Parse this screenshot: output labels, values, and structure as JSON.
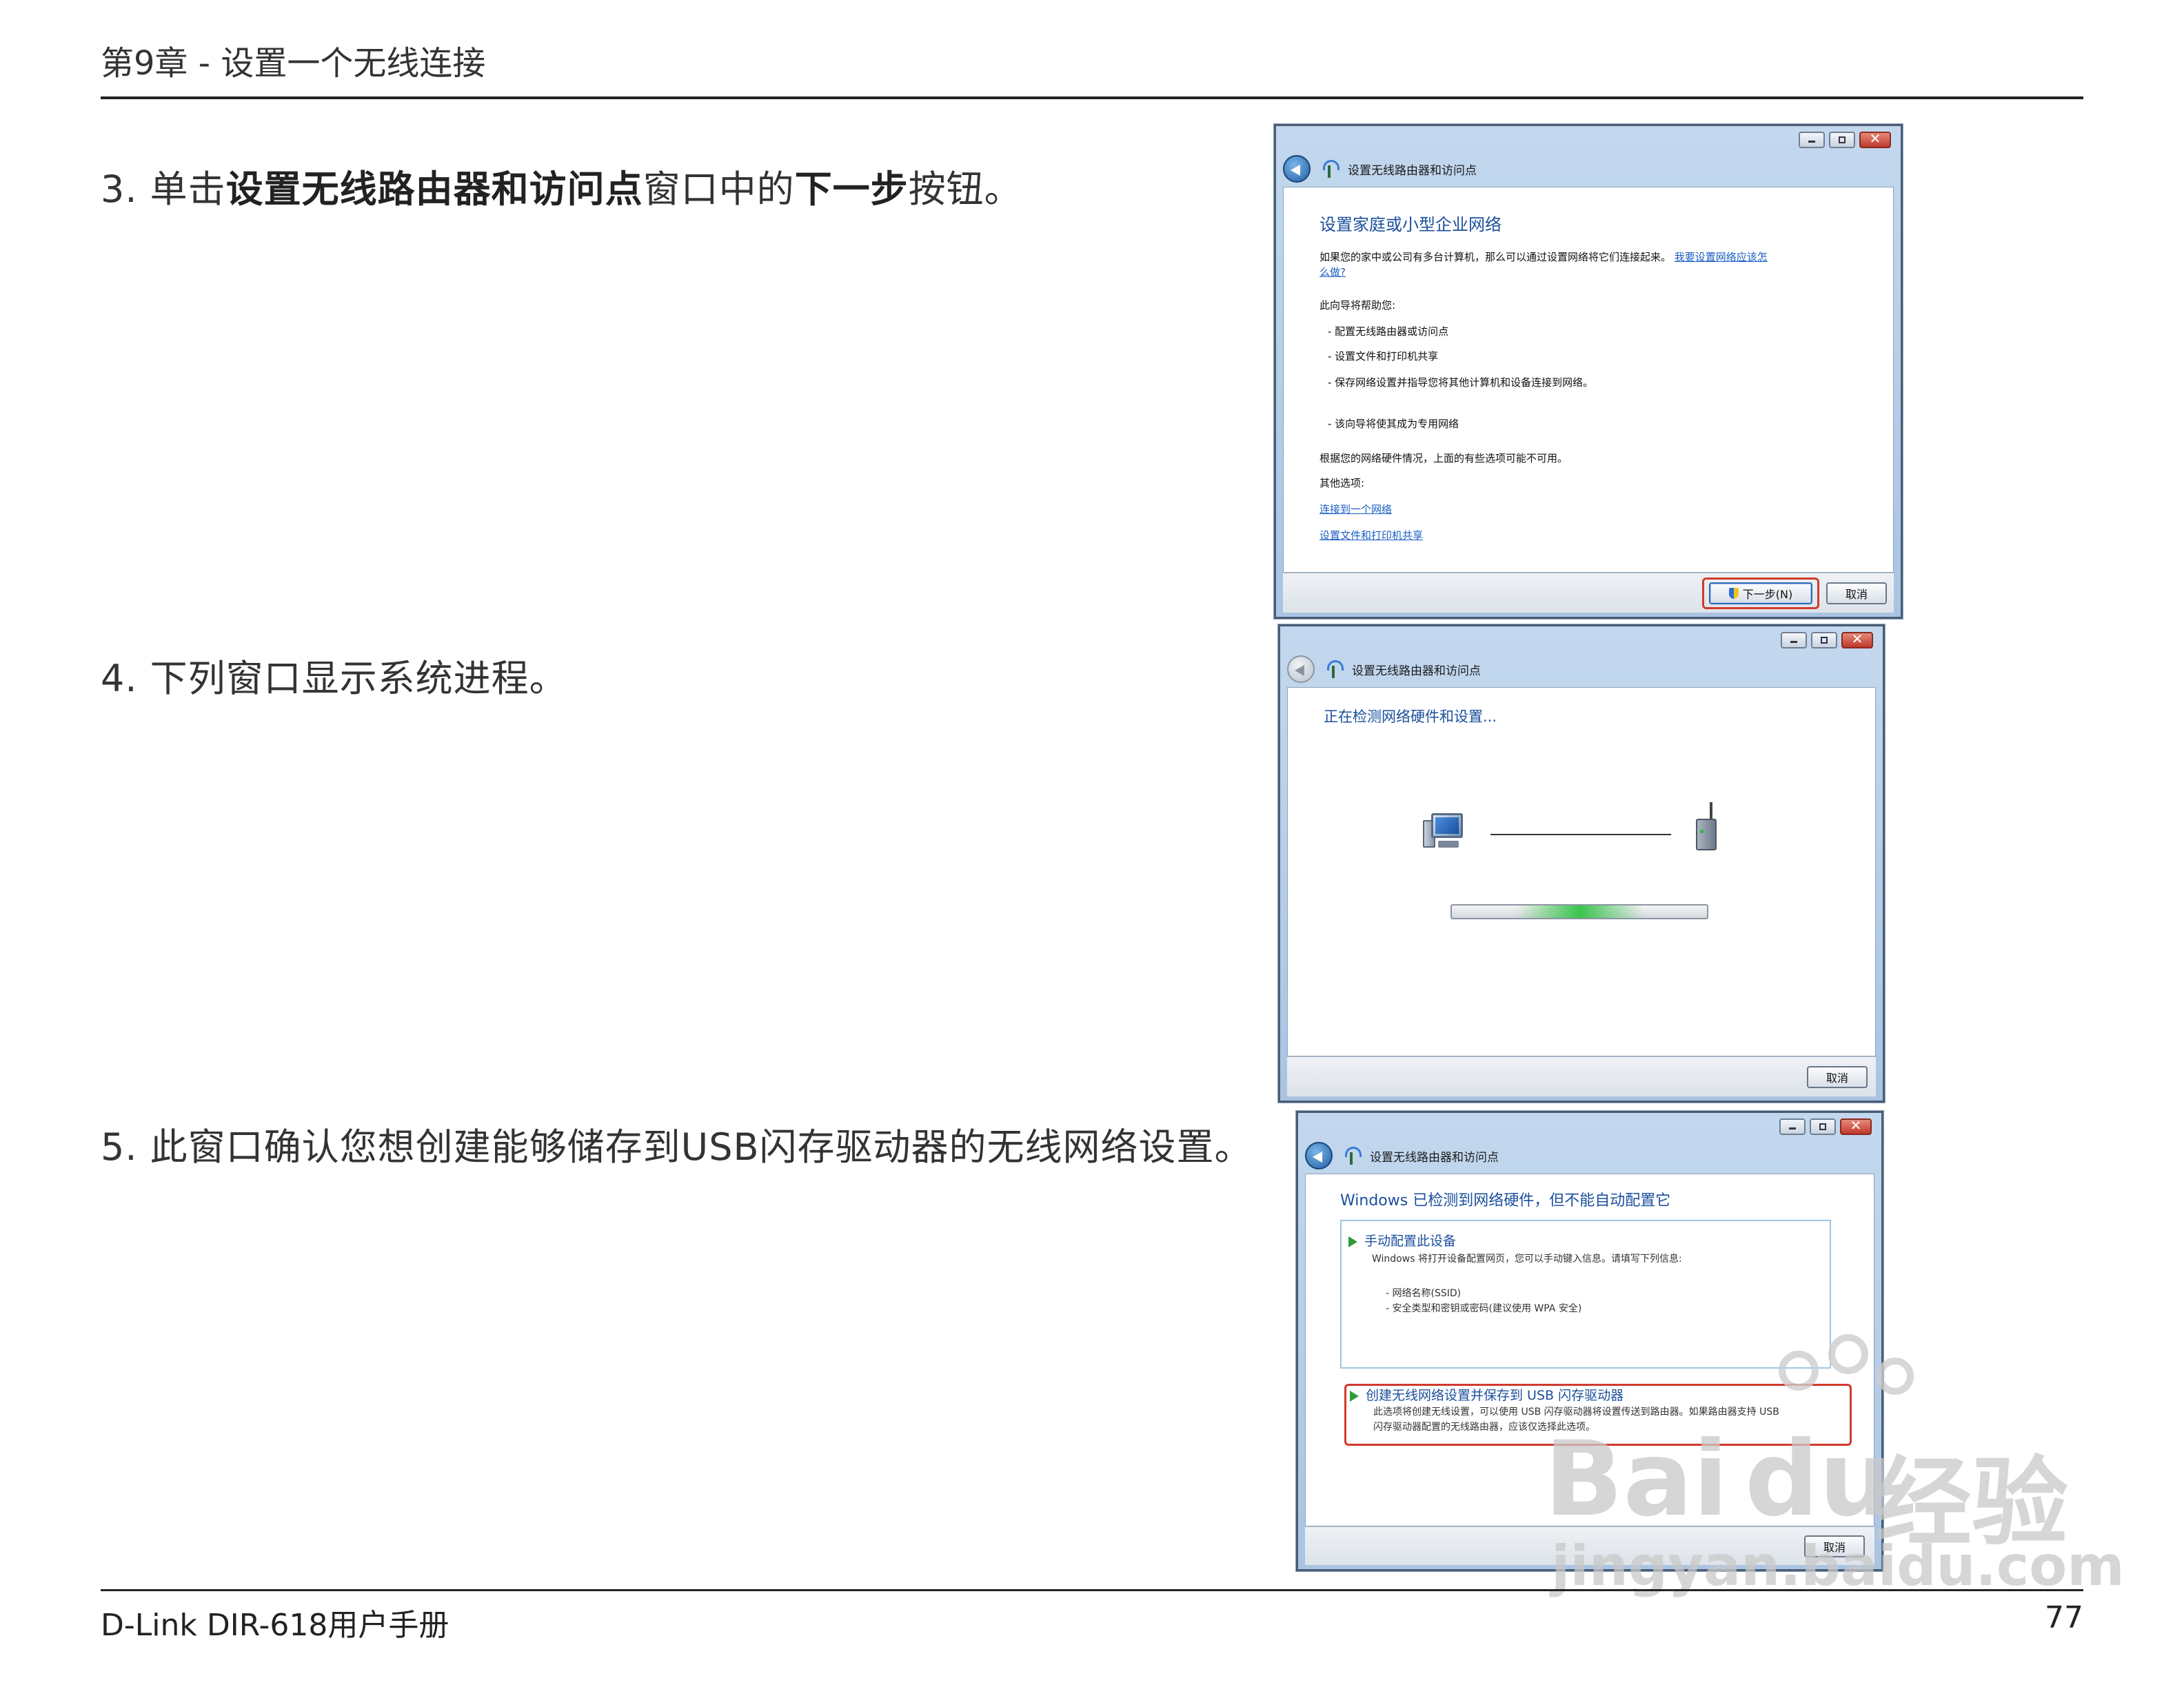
{
  "header": {
    "chapter": "第9章 - 设置一个无线连接"
  },
  "steps": [
    {
      "prefix": "3. 单击",
      "bold1": "设置无线路由器和访问点",
      "mid": "窗口中的",
      "bold2": "下一步",
      "suffix": "按钮。"
    },
    {
      "text": "4. 下列窗口显示系统进程。"
    },
    {
      "text": "5. 此窗口确认您想创建能够储存到USB闪存驱动器的无线网络设置。"
    }
  ],
  "footer": {
    "product": "D-Link DIR-618用户手册",
    "page": "77"
  },
  "window1": {
    "title": "设置无线路由器和访问点",
    "heading": "设置家庭或小型企业网络",
    "intro": "如果您的家中或公司有多台计算机，那么可以通过设置网络将它们连接起来。",
    "intro_link": "我要设置网络应该怎",
    "intro_link2": "么做?",
    "wizard_help": "此向导将帮助您:",
    "bullets": [
      "- 配置无线路由器或访问点",
      "- 设置文件和打印机共享",
      "- 保存网络设置并指导您将其他计算机和设备连接到网络。",
      "- 该向导将使其成为专用网络"
    ],
    "note": "根据您的网络硬件情况，上面的有些选项可能不可用。",
    "other": "其他选项:",
    "links": [
      "连接到一个网络",
      "设置文件和打印机共享"
    ],
    "next_button": "下一步(N)",
    "cancel_button": "取消"
  },
  "window2": {
    "title": "设置无线路由器和访问点",
    "status": "正在检测网络硬件和设置...",
    "progress": 0.5,
    "cancel_button": "取消"
  },
  "window3": {
    "title": "设置无线路由器和访问点",
    "heading": "Windows 已检测到网络硬件，但不能自动配置它",
    "option1_title": "手动配置此设备",
    "option1_desc": "Windows 将打开设备配置网页，您可以手动键入信息。请填写下列信息:",
    "option1_items": [
      "- 网络名称(SSID)",
      "- 安全类型和密钥或密码(建议使用 WPA 安全)"
    ],
    "option2_title": "创建无线网络设置并保存到 USB 闪存驱动器",
    "option2_desc1": "此选项将创建无线设置，可以使用 USB 闪存驱动器将设置传送到路由器。如果路由器支持 USB",
    "option2_desc2": "闪存驱动器配置的无线路由器，应该仅选择此选项。",
    "cancel_button": "取消"
  },
  "watermark": {
    "brand": "Bai",
    "brand2": "du",
    "cn": "经验",
    "site": "jingyan.baidu.com"
  },
  "colors": {
    "link": "#1a5dc4",
    "heading": "#1b4f9c",
    "highlight": "#d23a2c",
    "window_frame": "#a9c4e2"
  }
}
